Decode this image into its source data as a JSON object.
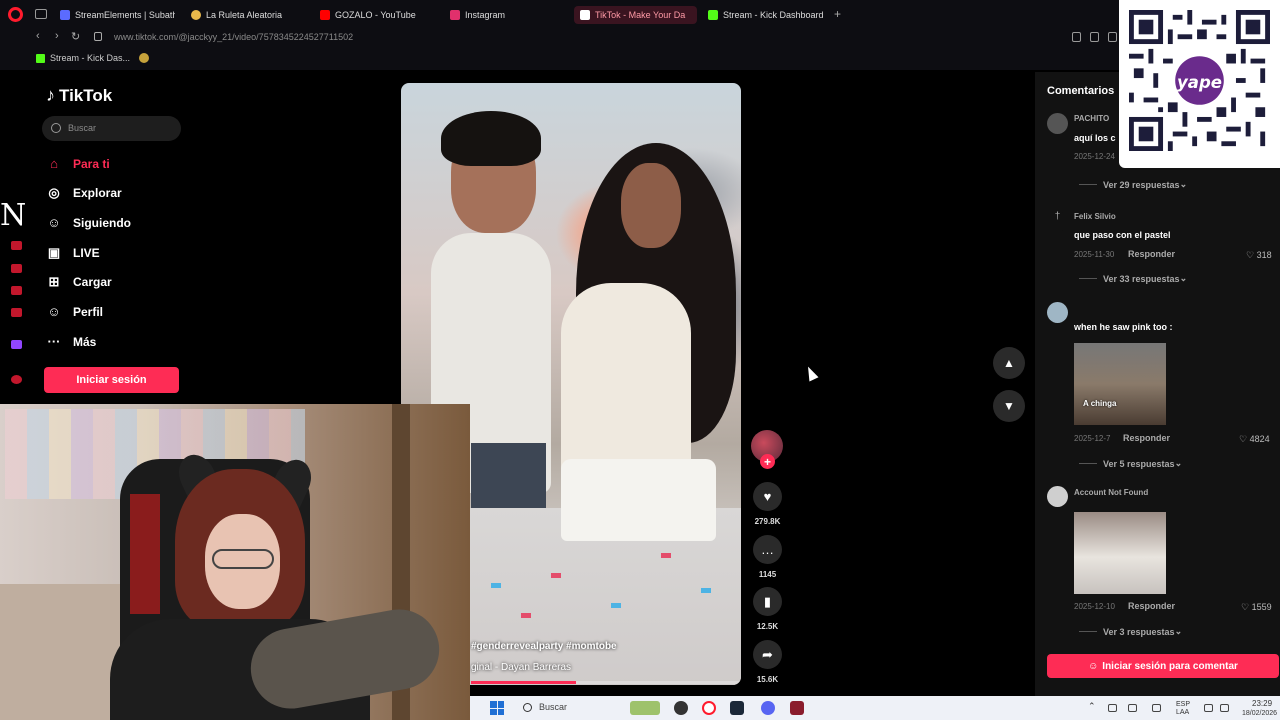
{
  "browser": {
    "tabs": [
      {
        "label": "StreamElements | Subatho",
        "color": "#5b6bff"
      },
      {
        "label": "La Ruleta Aleatoria",
        "color": "#e8b84b"
      },
      {
        "label": "GOZALO - YouTube",
        "color": "#ff0000"
      },
      {
        "label": "Instagram",
        "color": "#e1306c"
      },
      {
        "label": "TikTok - Make Your Da",
        "color": "#ffffff"
      },
      {
        "label": "Stream - Kick Dashboard",
        "color": "#53fc18"
      }
    ],
    "new_tab": "+",
    "url": "www.tiktok.com/@jacckyy_21/video/7578345224527711502",
    "bookmarks": [
      {
        "label": "Stream - Kick Das..."
      }
    ]
  },
  "side_letter": "N",
  "tiktok": {
    "logo": "TikTok",
    "search_placeholder": "Buscar",
    "nav": [
      {
        "label": "Para ti",
        "icon": "home-icon",
        "active": true
      },
      {
        "label": "Explorar",
        "icon": "compass-icon"
      },
      {
        "label": "Siguiendo",
        "icon": "following-icon"
      },
      {
        "label": "LIVE",
        "icon": "live-icon"
      },
      {
        "label": "Cargar",
        "icon": "upload-icon"
      },
      {
        "label": "Perfil",
        "icon": "profile-icon"
      },
      {
        "label": "Más",
        "icon": "more-icon"
      }
    ],
    "login_button": "Iniciar sesión",
    "video": {
      "caption": "#genderrevealparty #momtobe",
      "audio": "ginal - Dayan Barreras",
      "progress": 0.39
    },
    "actions": {
      "likes": "279.8K",
      "comments": "1145",
      "saves": "12.5K",
      "shares": "15.6K"
    }
  },
  "comments": {
    "title": "Comentarios",
    "items": [
      {
        "user": "PACHITO",
        "text": "aquí los c",
        "date": "2025-12-24",
        "more": "Ver 29 respuestas"
      },
      {
        "user": "Felix Silvio",
        "text": "que paso con el pastel",
        "date": "2025-11-30",
        "reply": "Responder",
        "likes": "318",
        "more": "Ver 33 respuestas"
      },
      {
        "user": "",
        "text": "when he saw pink too :",
        "image_caption": "A chinga",
        "date": "2025-12-7",
        "reply": "Responder",
        "likes": "4824",
        "more": "Ver 5 respuestas"
      },
      {
        "user": "Account Not Found",
        "date": "2025-12-10",
        "reply": "Responder",
        "likes": "1559",
        "more": "Ver 3 respuestas"
      }
    ],
    "login_button": "Iniciar sesión para comentar"
  },
  "qr": {
    "brand": "yape"
  },
  "taskbar": {
    "search": "Buscar",
    "lang_top": "ESP",
    "lang_bottom": "LAA",
    "time": "23:29",
    "date": "18/02/2026"
  },
  "colors": {
    "accent": "#fe2c55",
    "opera": "#ff1b2d"
  }
}
